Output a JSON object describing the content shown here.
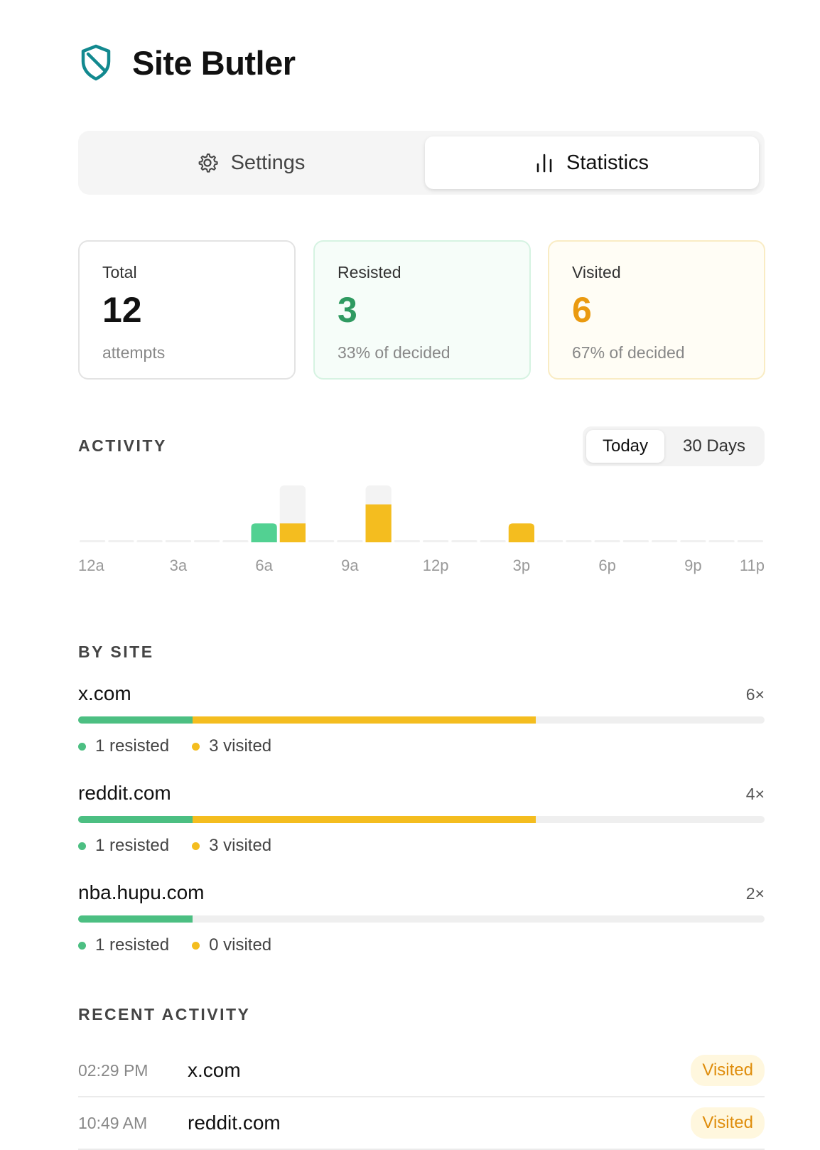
{
  "app": {
    "title": "Site Butler",
    "logo_icon": "shield-icon",
    "brand_color": "#12898f"
  },
  "tabs": [
    {
      "label": "Settings",
      "icon": "gear-icon",
      "active": false
    },
    {
      "label": "Statistics",
      "icon": "bar-chart-icon",
      "active": true
    }
  ],
  "summary": {
    "total": {
      "label": "Total",
      "value": "12",
      "sub": "attempts"
    },
    "resisted": {
      "label": "Resisted",
      "value": "3",
      "sub": "33% of decided",
      "color": "#2f9a61"
    },
    "visited": {
      "label": "Visited",
      "value": "6",
      "sub": "67% of decided",
      "color": "#ea9a10"
    }
  },
  "activity": {
    "title": "ACTIVITY",
    "range_options": [
      "Today",
      "30 Days"
    ],
    "selected_range": "Today"
  },
  "chart_data": {
    "type": "bar",
    "hours": 24,
    "tick_labels": [
      "12a",
      "3a",
      "6a",
      "9a",
      "12p",
      "3p",
      "6p",
      "9p",
      "11p"
    ],
    "tick_hours": [
      0,
      3,
      6,
      9,
      12,
      15,
      18,
      21,
      23
    ],
    "series": [
      {
        "name": "resisted",
        "color": "#52d192",
        "values": [
          0,
          0,
          0,
          0,
          0,
          0,
          1,
          0,
          0,
          0,
          0,
          0,
          0,
          0,
          0,
          0,
          0,
          0,
          0,
          0,
          0,
          0,
          0,
          0
        ]
      },
      {
        "name": "visited",
        "color": "#f4bd1f",
        "values": [
          0,
          0,
          0,
          0,
          0,
          0,
          0,
          1,
          0,
          0,
          2,
          0,
          0,
          0,
          0,
          1,
          0,
          0,
          0,
          0,
          0,
          0,
          0,
          0
        ]
      },
      {
        "name": "undecided",
        "color": "#f3f3f3",
        "values": [
          0,
          0,
          0,
          0,
          0,
          0,
          0,
          2,
          0,
          0,
          1,
          0,
          0,
          0,
          0,
          0,
          0,
          0,
          0,
          0,
          0,
          0,
          0,
          0
        ]
      }
    ],
    "ylim": [
      0,
      3
    ]
  },
  "by_site": {
    "title": "BY SITE",
    "resisted_suffix": "resisted",
    "visited_suffix": "visited",
    "sites": [
      {
        "name": "x.com",
        "count": "6×",
        "total": 6,
        "resisted": 1,
        "visited": 3,
        "resisted_label": "1",
        "visited_label": "3"
      },
      {
        "name": "reddit.com",
        "count": "4×",
        "total": 4,
        "resisted": 1,
        "visited": 3,
        "resisted_label": "1",
        "visited_label": "3"
      },
      {
        "name": "nba.hupu.com",
        "count": "2×",
        "total": 2,
        "resisted": 1,
        "visited": 0,
        "resisted_label": "1",
        "visited_label": "0"
      }
    ]
  },
  "recent": {
    "title": "RECENT ACTIVITY",
    "items": [
      {
        "time": "02:29 PM",
        "site": "x.com",
        "status": "Visited"
      },
      {
        "time": "10:49 AM",
        "site": "reddit.com",
        "status": "Visited"
      }
    ]
  }
}
